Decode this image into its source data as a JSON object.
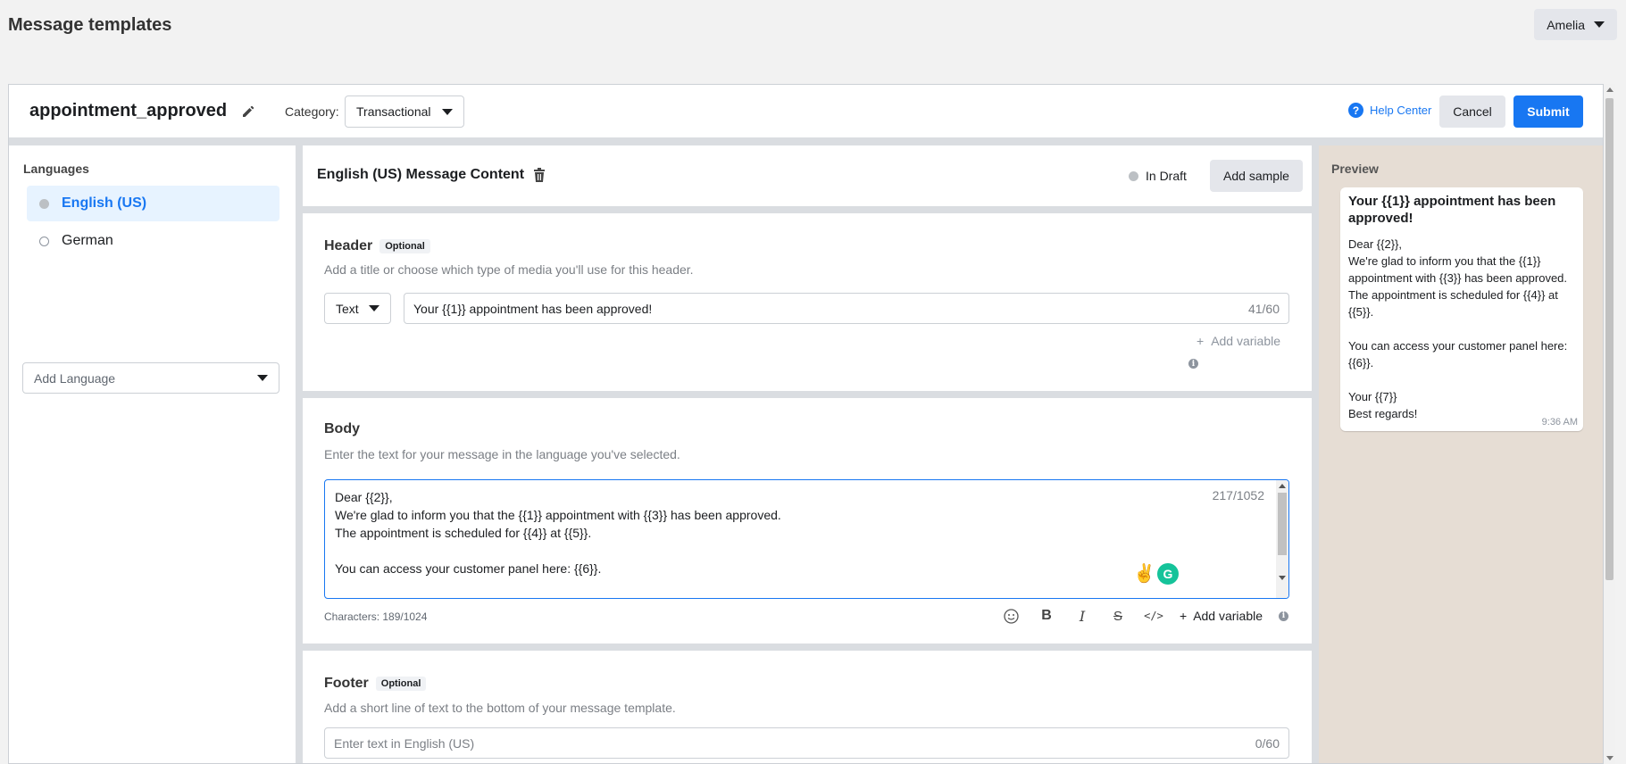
{
  "app": {
    "title": "Message templates",
    "user": "Amelia"
  },
  "template": {
    "name": "appointment_approved",
    "category_label": "Category:",
    "category_value": "Transactional",
    "help_label": "Help Center",
    "cancel_label": "Cancel",
    "submit_label": "Submit"
  },
  "languages": {
    "title": "Languages",
    "items": [
      {
        "label": "English (US)",
        "active": true
      },
      {
        "label": "German",
        "active": false
      }
    ],
    "add_placeholder": "Add Language"
  },
  "content": {
    "title": "English (US) Message Content",
    "status": "In Draft",
    "add_sample_label": "Add sample"
  },
  "header_section": {
    "title": "Header",
    "optional": "Optional",
    "description": "Add a title or choose which type of media you'll use for this header.",
    "type_value": "Text",
    "text_value": "Your {{1}} appointment has been approved!",
    "counter": "41/60",
    "add_variable": "Add variable"
  },
  "body_section": {
    "title": "Body",
    "description": "Enter the text for your message in the language you've selected.",
    "text": "Dear {{2}},\nWe're glad to inform you that the {{1}} appointment with {{3}} has been approved.\nThe appointment is scheduled for {{4}} at {{5}}.\n\nYou can access your customer panel here: {{6}}.\n\nYour {{7}}",
    "counter": "217/1052",
    "characters": "Characters: 189/1024",
    "add_variable": "Add variable"
  },
  "footer_section": {
    "title": "Footer",
    "optional": "Optional",
    "description": "Add a short line of text to the bottom of your message template.",
    "placeholder": "Enter text in English (US)",
    "counter": "0/60"
  },
  "preview": {
    "title": "Preview",
    "bubble_title": "Your {{1}} appointment has been approved!",
    "bubble_body": "Dear {{2}},\nWe're glad to inform you that the {{1}} appointment with {{3}} has been approved.\nThe appointment is scheduled for {{4}} at {{5}}.\n\nYou can access your customer panel here: {{6}}.\n\nYour {{7}}\nBest regards!",
    "time": "9:36 AM"
  },
  "colors": {
    "accent": "#1877f2",
    "background": "#f2f2f2",
    "preview_bg": "#e6ddd4"
  },
  "icons": [
    "caret-down-icon",
    "pencil-icon",
    "help-icon",
    "trash-icon",
    "plus-icon",
    "info-icon",
    "emoji-icon",
    "bold-icon",
    "italic-icon",
    "strikethrough-icon",
    "code-icon",
    "victory-hand-icon",
    "grammarly-icon"
  ]
}
